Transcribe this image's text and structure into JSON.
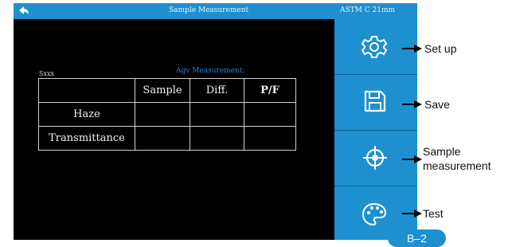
{
  "topbar": {
    "title": "Sample Measurement",
    "standard": "ASTM C 21mm",
    "back_icon": "back-arrow-icon"
  },
  "sidebar": {
    "buttons": [
      {
        "id": "setup",
        "icon": "gear-icon"
      },
      {
        "id": "save",
        "icon": "floppy-disk-icon"
      },
      {
        "id": "sample-measurement",
        "icon": "crosshair-icon"
      },
      {
        "id": "test",
        "icon": "palette-icon"
      }
    ]
  },
  "main": {
    "sample_name": "Sxxx",
    "average_label": "Agv Measurement:",
    "table": {
      "headers": [
        "",
        "Sample",
        "Diff.",
        "P/F"
      ],
      "rows": [
        {
          "label": "Haze",
          "cells": [
            "",
            "",
            ""
          ]
        },
        {
          "label": "Transmittance",
          "cells": [
            "",
            "",
            ""
          ]
        }
      ]
    }
  },
  "annotations": {
    "setup": "Set up",
    "save": "Save",
    "sample_line1": "Sample",
    "sample_line2": "measurement",
    "test": "Test",
    "figure_label": "B–2"
  },
  "colors": {
    "accent": "#1e90d0",
    "screen_bg": "#000000",
    "avg_label": "#2e7fc8"
  }
}
